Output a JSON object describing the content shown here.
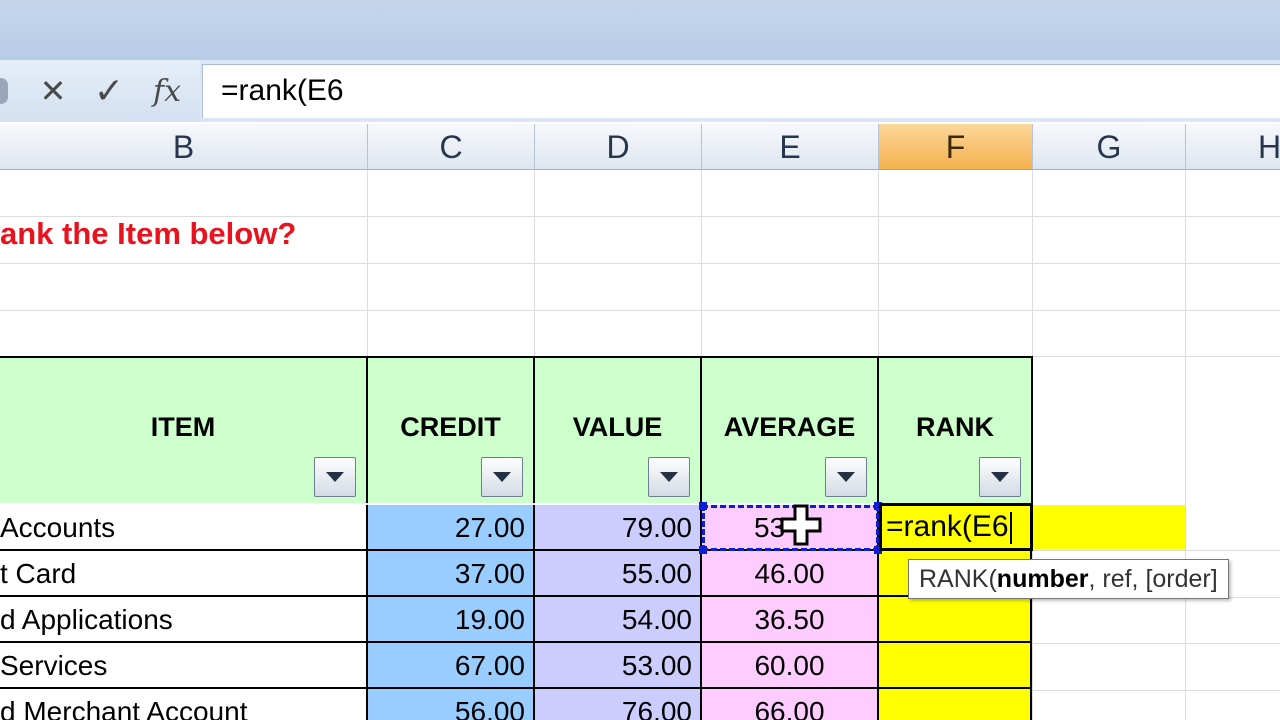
{
  "formula_bar": {
    "cancel_icon": "x-icon",
    "enter_icon": "check-icon",
    "fx_label": "fx",
    "content": "=rank(E6"
  },
  "columns": [
    "B",
    "C",
    "D",
    "E",
    "F",
    "G",
    "H"
  ],
  "active_column": "F",
  "sheet": {
    "title": "ank the Item below?",
    "headers": {
      "item": "ITEM",
      "credit": "CREDIT",
      "value": "VALUE",
      "average": "AVERAGE",
      "rank": "RANK"
    },
    "rows": [
      {
        "item": "Accounts",
        "credit": "27.00",
        "value": "79.00",
        "average": "53",
        "rank": ""
      },
      {
        "item": "t Card",
        "credit": "37.00",
        "value": "55.00",
        "average": "46.00",
        "rank": ""
      },
      {
        "item": "d Applications",
        "credit": "19.00",
        "value": "54.00",
        "average": "36.50",
        "rank": ""
      },
      {
        "item": "Services",
        "credit": "67.00",
        "value": "53.00",
        "average": "60.00",
        "rank": ""
      },
      {
        "item": "d Merchant Account",
        "credit": "56.00",
        "value": "76.00",
        "average": "66.00",
        "rank": ""
      }
    ],
    "editing_cell": "=rank(E6"
  },
  "tooltip": {
    "prefix": "RANK(",
    "bold_arg": "number",
    "rest": ", ref, [order]"
  },
  "colors": {
    "title_red": "#e8131f",
    "header_green": "#ccffcc",
    "credit_blue": "#99ccff",
    "value_lavender": "#ccccff",
    "average_pink": "#ffccff",
    "rank_yellow": "#ffff00",
    "active_col_orange": "#f5b14e"
  }
}
